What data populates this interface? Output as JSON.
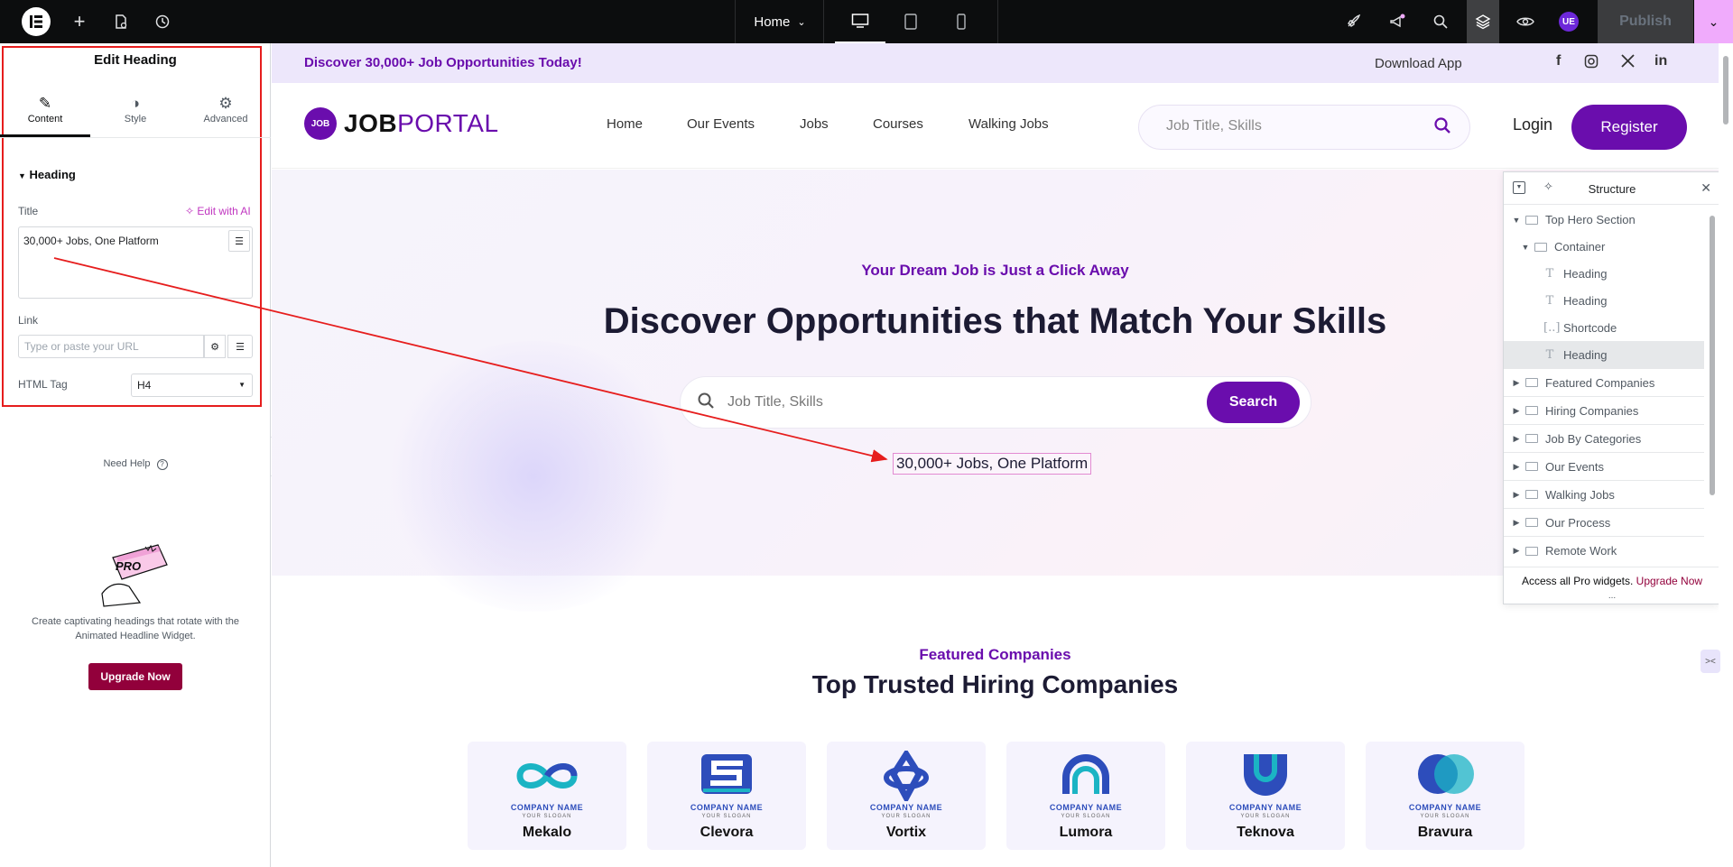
{
  "topbar": {
    "page_name": "Home",
    "avatar_initials": "UE",
    "publish_label": "Publish"
  },
  "panel": {
    "title": "Edit Heading",
    "tabs": [
      {
        "label": "Content",
        "icon": "pencil-icon"
      },
      {
        "label": "Style",
        "icon": "contrast-icon"
      },
      {
        "label": "Advanced",
        "icon": "gear-icon"
      }
    ],
    "section_title": "Heading",
    "title_label": "Title",
    "ai_link": "Edit with AI",
    "title_value": "30,000+ Jobs, One Platform",
    "link_label": "Link",
    "link_placeholder": "Type or paste your URL",
    "html_tag_label": "HTML Tag",
    "html_tag_value": "H4",
    "need_help": "Need Help",
    "promo_text": "Create captivating headings that rotate with the Animated Headline Widget.",
    "upgrade_label": "Upgrade Now",
    "pro_badge": "PRO"
  },
  "site": {
    "announcement": "Discover 30,000+ Job Opportunities Today!",
    "download_app": "Download App",
    "logo_badge": "JOB",
    "logo_bold": "JOB",
    "logo_light": "PORTAL",
    "nav": [
      "Home",
      "Our Events",
      "Jobs",
      "Courses",
      "Walking Jobs"
    ],
    "header_search_placeholder": "Job Title, Skills",
    "login": "Login",
    "register": "Register",
    "hero_subtitle": "Your Dream Job is Just a Click Away",
    "hero_title": "Discover Opportunities that Match Your Skills",
    "hero_search_placeholder": "Job Title, Skills",
    "hero_search_button": "Search",
    "hero_tagline": "30,000+ Jobs, One Platform",
    "featured_subtitle": "Featured Companies",
    "featured_title": "Top Trusted Hiring Companies",
    "company_label": "COMPANY NAME",
    "company_slogan": "YOUR SLOGAN",
    "companies": [
      "Mekalo",
      "Clevora",
      "Vortix",
      "Lumora",
      "Teknova",
      "Bravura"
    ]
  },
  "structure": {
    "title": "Structure",
    "items": [
      {
        "label": "Top Hero Section",
        "level": 0,
        "expanded": true
      },
      {
        "label": "Container",
        "level": 1,
        "expanded": true
      },
      {
        "label": "Heading",
        "level": 2
      },
      {
        "label": "Heading",
        "level": 2
      },
      {
        "label": "Shortcode",
        "level": 2
      },
      {
        "label": "Heading",
        "level": 2,
        "selected": true
      },
      {
        "label": "Featured Companies",
        "level": 0
      },
      {
        "label": "Hiring Companies",
        "level": 0
      },
      {
        "label": "Job By Categories",
        "level": 0
      },
      {
        "label": "Our Events",
        "level": 0
      },
      {
        "label": "Walking Jobs",
        "level": 0
      },
      {
        "label": "Our Process",
        "level": 0
      },
      {
        "label": "Remote Work",
        "level": 0
      }
    ],
    "footer_text": "Access all Pro widgets.",
    "footer_link": "Upgrade Now",
    "more": "..."
  },
  "colors": {
    "brand_purple": "#6a0dad",
    "elementor_pink": "#92003b",
    "annotation_red": "#e61d1d"
  }
}
